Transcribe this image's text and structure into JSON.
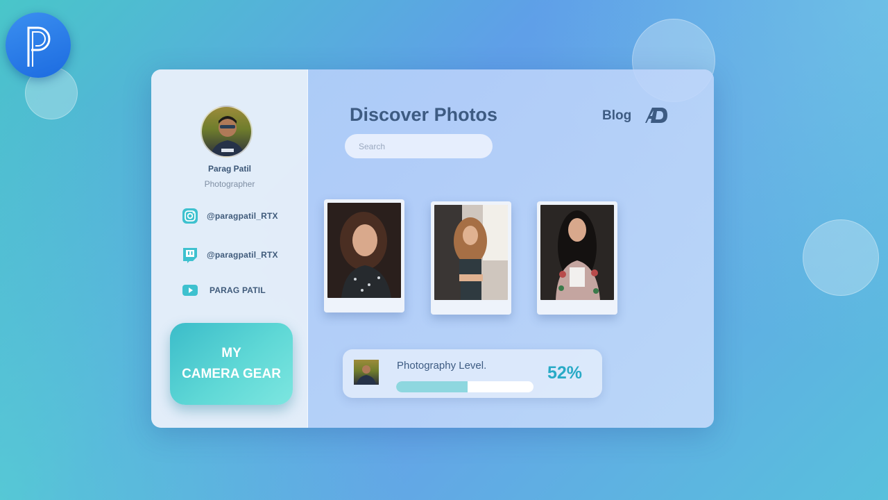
{
  "profile": {
    "name": "Parag Patil",
    "role": "Photographer"
  },
  "social": [
    {
      "icon": "instagram-icon",
      "label": "@paragpatil_RTX"
    },
    {
      "icon": "twitch-icon",
      "label": "@paragpatil_RTX"
    },
    {
      "icon": "youtube-icon",
      "label": "PARAG PATIL"
    }
  ],
  "gear_button": {
    "line1": "MY",
    "line2": "CAMERA GEAR"
  },
  "header": {
    "title": "Discover Photos",
    "nav_blog": "Blog"
  },
  "search": {
    "placeholder": "Search",
    "value": ""
  },
  "level": {
    "label": "Photography Level.",
    "percent_text": "52%",
    "percent": 52
  },
  "colors": {
    "accent": "#28aac6",
    "title": "#3d5b82",
    "gear_button": "#4ecdd0",
    "progress_fill": "#8ed7df",
    "logo_badge": "#2a7de8"
  },
  "icons": {
    "logo": "picsart-logo-icon",
    "brand": "ad-brand-icon",
    "next": "chevron-right-icon"
  }
}
